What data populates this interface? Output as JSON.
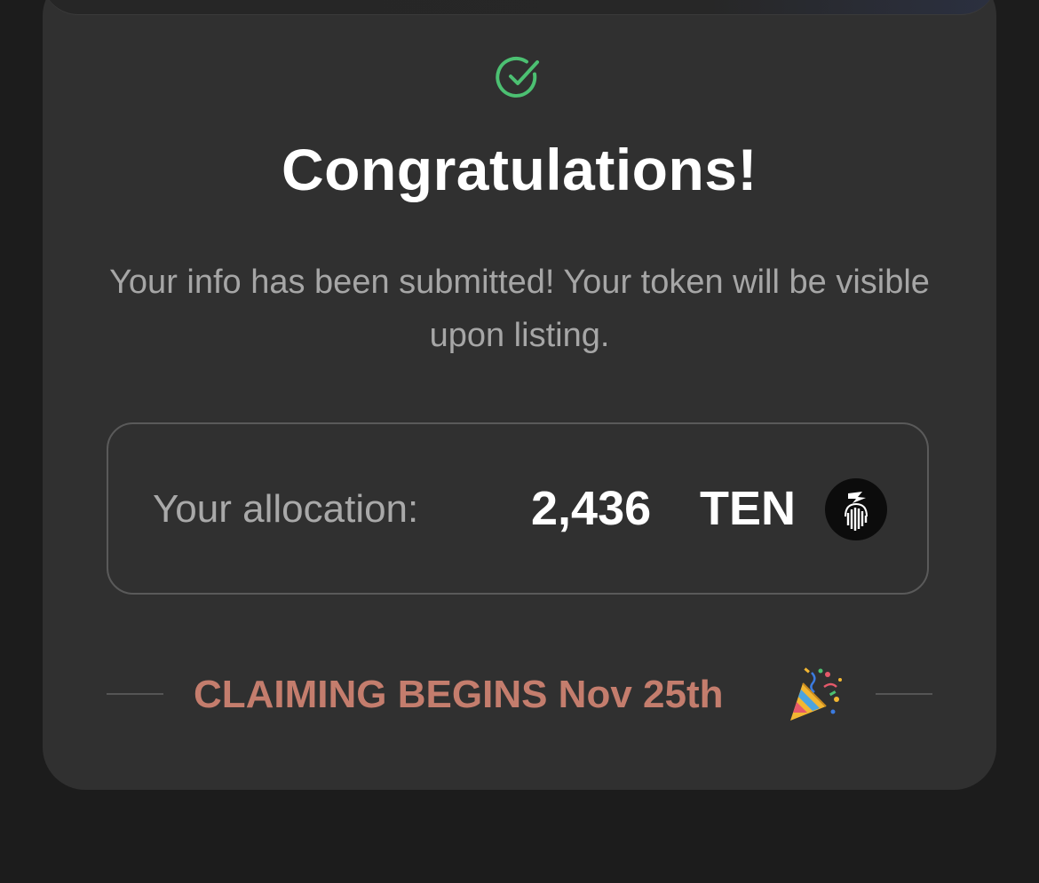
{
  "dialog": {
    "status_icon": "check-circle-icon",
    "title": "Congratulations!",
    "message": "Your info has been submitted! Your token will be visible upon listing."
  },
  "allocation": {
    "label": "Your allocation:",
    "amount": "2,436",
    "unit": "TEN",
    "token_icon": "ten-token-icon"
  },
  "claim": {
    "text": "CLAIMING BEGINS Nov 25th",
    "icon": "party-popper-icon"
  },
  "colors": {
    "background": "#1c1c1c",
    "card": "#303030",
    "success": "#4cc072",
    "accent": "#c47d6d",
    "muted_text": "#a6a6a6"
  }
}
